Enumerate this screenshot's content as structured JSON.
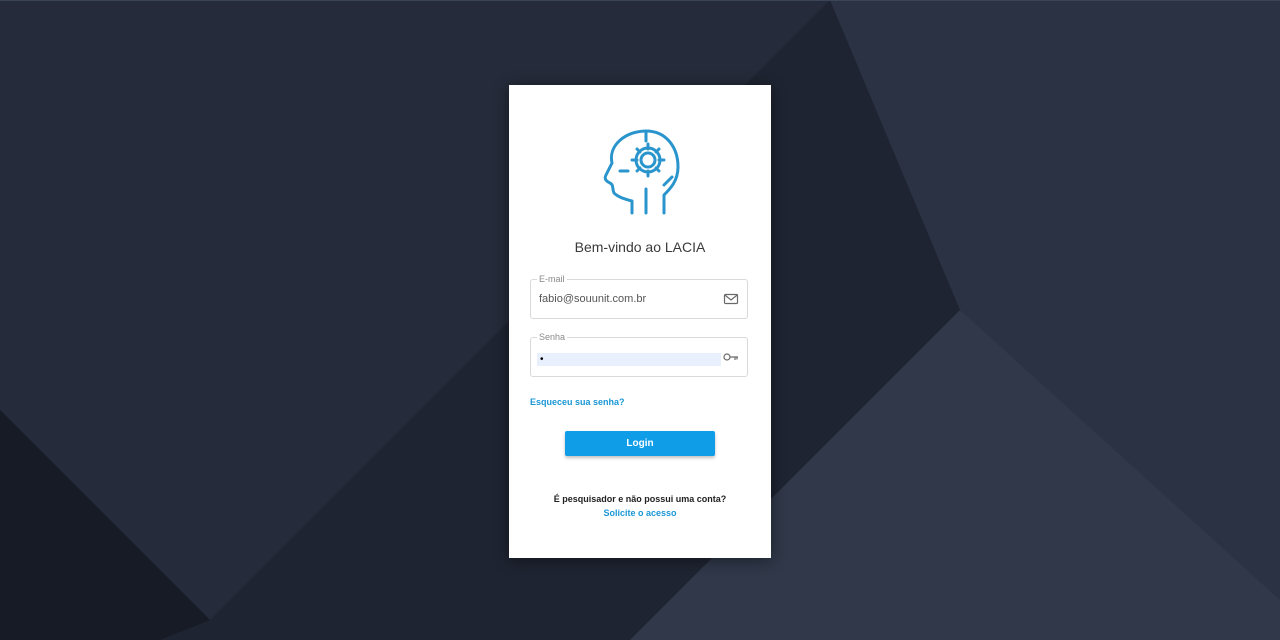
{
  "login": {
    "welcome": "Bem-vindo ao LACIA",
    "email": {
      "label": "E-mail",
      "value": "fabio@souunit.com.br",
      "icon": "envelope-icon"
    },
    "password": {
      "label": "Senha",
      "masked_value": "•",
      "icon": "key-icon"
    },
    "forgot_link": "Esqueceu sua senha?",
    "login_button": "Login",
    "researcher_prompt": "É pesquisador e não possui uma conta?",
    "request_link": "Solicite o acesso"
  },
  "logo": {
    "icon": "brain-gear-head-icon"
  },
  "colors": {
    "background": "#202634",
    "accent": "#1a97d6",
    "button": "#0f9de8",
    "autofill": "#e8f0fe"
  }
}
